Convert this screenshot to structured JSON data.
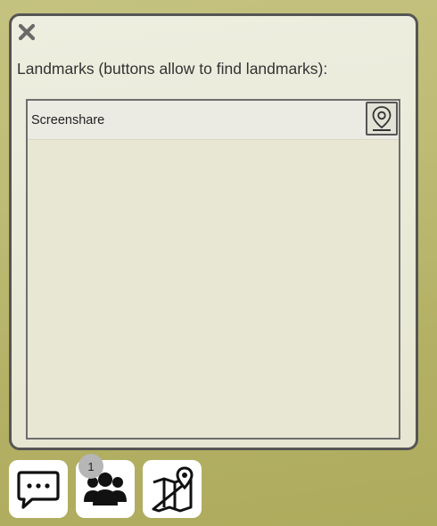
{
  "dialog": {
    "title": "Landmarks (buttons allow to find landmarks):",
    "close_icon": "close-icon"
  },
  "landmarks": [
    {
      "label": "Screenshare",
      "action_icon": "map-pin-icon"
    }
  ],
  "dock": {
    "chat_icon": "chat-icon",
    "users_icon": "users-icon",
    "users_count": "1",
    "map_icon": "map-location-icon"
  }
}
